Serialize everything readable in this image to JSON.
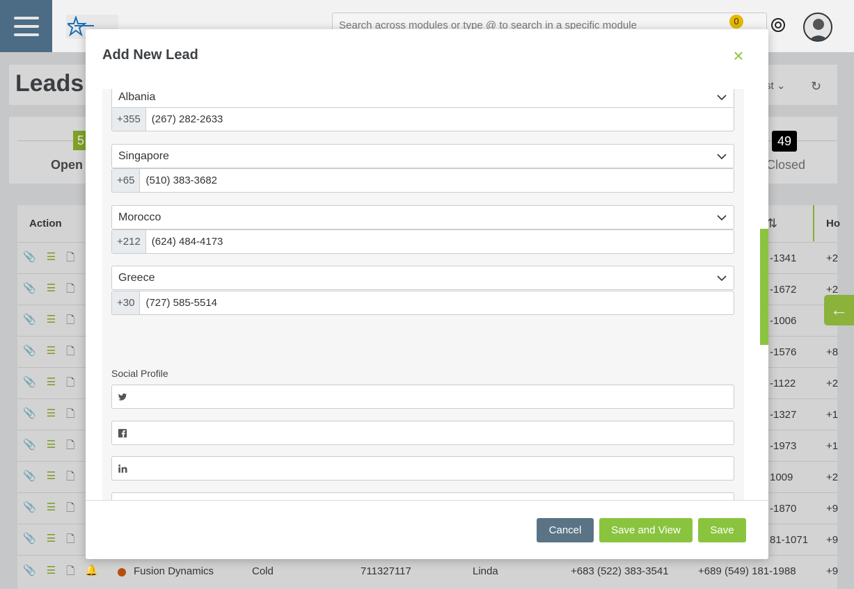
{
  "header": {
    "search_placeholder": "Search across modules or type @ to search in a specific module",
    "notification_count": "0"
  },
  "page": {
    "title": "Leads",
    "list_selector": "st",
    "open_count": "5",
    "open_label": "Open",
    "closed_count": "49",
    "closed_label": "Closed"
  },
  "table": {
    "action_header": "Action",
    "partial_header": "Ho",
    "rows_right": [
      {
        "col1": "-1341",
        "col2": "+2"
      },
      {
        "col1": "-1672",
        "col2": "+2"
      },
      {
        "col1": "-1006",
        "col2": "+2"
      },
      {
        "col1": "-1576",
        "col2": "+8"
      },
      {
        "col1": "-1122",
        "col2": "+2"
      },
      {
        "col1": "-1327",
        "col2": "+1"
      },
      {
        "col1": "-1973",
        "col2": "+1"
      },
      {
        "col1": "1009",
        "col2": "+2"
      },
      {
        "col1": "-1870",
        "col2": "+9"
      },
      {
        "col1": "81-1071",
        "col2": "+9"
      }
    ],
    "last_row": {
      "company": "Fusion Dynamics",
      "status": "Cold",
      "id": "711327117",
      "contact": "Linda",
      "phone1": "+683 (522) 383-3541",
      "phone2": "+689 (549) 181-1988",
      "col_partial": "+9"
    }
  },
  "modal": {
    "title": "Add New Lead",
    "phones": [
      {
        "country": "Albania",
        "code": "+355",
        "number": "(267) 282-2633"
      },
      {
        "country": "Singapore",
        "code": "+65",
        "number": "(510) 383-3682"
      },
      {
        "country": "Morocco",
        "code": "+212",
        "number": "(624) 484-4173"
      },
      {
        "country": "Greece",
        "code": "+30",
        "number": "(727) 585-5514"
      }
    ],
    "social_label": "Social Profile",
    "social_icons": [
      "twitter-icon",
      "facebook-icon",
      "linkedin-icon",
      "instagram-icon"
    ],
    "buttons": {
      "cancel": "Cancel",
      "save_and_view": "Save and View",
      "save": "Save"
    }
  },
  "colors": {
    "accent_green": "#8ac43f",
    "cancel_gray": "#5b7485",
    "sidebar_blue": "#4b6c84"
  }
}
